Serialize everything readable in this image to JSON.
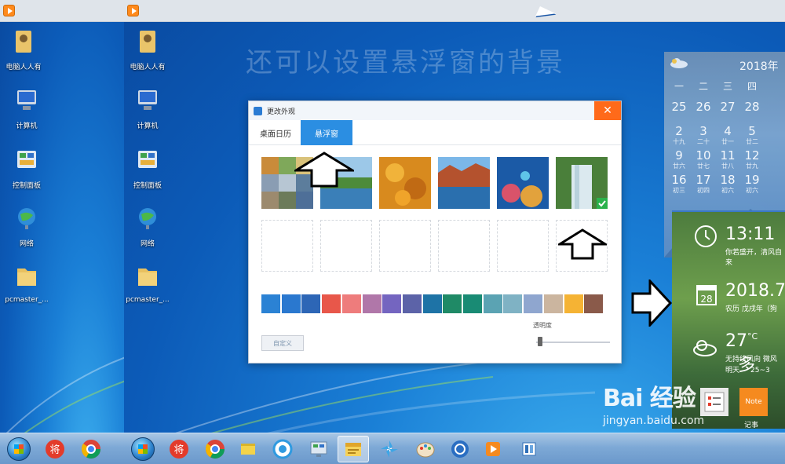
{
  "title_overlay": "还可以设置悬浮窗的背景",
  "desktop_icons": [
    {
      "label": "电脑人人有",
      "icon": "folder-user-icon"
    },
    {
      "label": "计算机",
      "icon": "computer-icon"
    },
    {
      "label": "控制面板",
      "icon": "control-panel-icon"
    },
    {
      "label": "网络",
      "icon": "network-icon"
    },
    {
      "label": "pcmaster_...",
      "icon": "folder-icon"
    }
  ],
  "dialog": {
    "title": "更改外观",
    "close": "✕",
    "tabs": [
      {
        "label": "桌面日历",
        "active": false
      },
      {
        "label": "悬浮窗",
        "active": true
      }
    ],
    "thumbnails": [
      "collage",
      "lake-forest",
      "autumn-leaves",
      "red-rocks-sea",
      "coral-reef",
      "waterfall"
    ],
    "selected_thumbnail": 5,
    "empty_slots": 6,
    "swatches": [
      "#2b82d4",
      "#2a78cf",
      "#2d66b6",
      "#e8574a",
      "#ee7c7c",
      "#b077a9",
      "#7465c0",
      "#5c63a8",
      "#1e73a6",
      "#1f8a66",
      "#198b74",
      "#5ba3b3",
      "#7fb2c4",
      "#8fa6cf",
      "#cbb59f",
      "#f5b334",
      "#8a5a4a"
    ],
    "custom_button": "自定义",
    "opacity_label": "透明度",
    "opacity_value": 0.05
  },
  "calendar": {
    "year_label": "2018年",
    "weekdays": [
      "一",
      "二",
      "三",
      "四"
    ],
    "rows": [
      [
        {
          "n": "25",
          "s": ""
        },
        {
          "n": "26",
          "s": ""
        },
        {
          "n": "27",
          "s": ""
        },
        {
          "n": "28",
          "s": ""
        }
      ],
      [
        {
          "n": "2",
          "s": "十九"
        },
        {
          "n": "3",
          "s": "二十"
        },
        {
          "n": "4",
          "s": "廿一"
        },
        {
          "n": "5",
          "s": "廿二"
        }
      ],
      [
        {
          "n": "9",
          "s": "廿六"
        },
        {
          "n": "10",
          "s": "廿七"
        },
        {
          "n": "11",
          "s": "廿八"
        },
        {
          "n": "12",
          "s": "廿九"
        }
      ],
      [
        {
          "n": "16",
          "s": "初三"
        },
        {
          "n": "17",
          "s": "初四"
        },
        {
          "n": "18",
          "s": "初六"
        },
        {
          "n": "19",
          "s": "初六"
        }
      ]
    ]
  },
  "widget": {
    "time": "13:11",
    "time_caption": "你若盛开，清风自来",
    "date": "2018.7",
    "date_caption": "农历 戊戌年（狗",
    "date_icon_text": "28",
    "temp": "27",
    "temp_unit": "°C",
    "temp_trail": "多",
    "wind": "无持续风向 微风",
    "tomorrow": "明天",
    "tomorrow_range": "25~3",
    "note_label": "Note",
    "note_caption": "记事"
  },
  "watermark": {
    "logo": "Bai 经验",
    "url": "jingyan.baidu.com"
  }
}
